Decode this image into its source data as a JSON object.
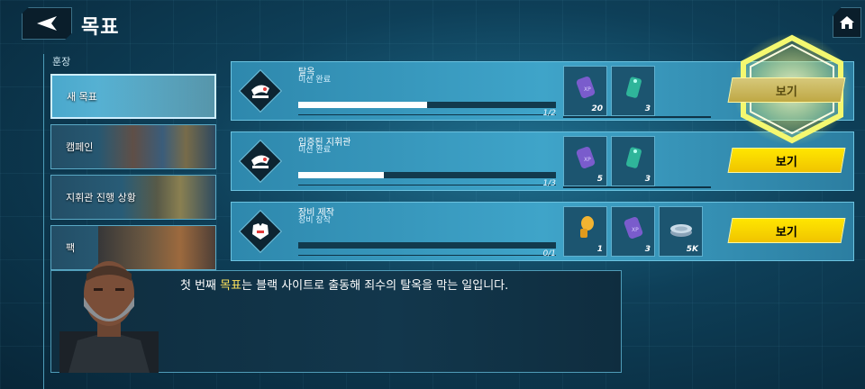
{
  "header": {
    "title": "목표",
    "back_icon": "back-arrow-icon",
    "home_icon": "home-icon"
  },
  "sidebar": {
    "header": "훈장",
    "items": [
      {
        "label": "새 목표",
        "active": true
      },
      {
        "label": "캠페인",
        "active": false
      },
      {
        "label": "지휘관 진행 상황",
        "active": false
      },
      {
        "label": "팩",
        "active": false
      }
    ]
  },
  "missions": [
    {
      "title": "탈옥",
      "subtitle": "미션 완료",
      "progress_text": "1/2",
      "progress": 0.5,
      "button": "보기",
      "button_highlighted": true,
      "rewards": [
        {
          "icon": "purple-xp-tag-icon",
          "qty": "20"
        },
        {
          "icon": "teal-dogtag-icon",
          "qty": "3"
        }
      ]
    },
    {
      "title": "입증된 지휘관",
      "subtitle": "미션 완료",
      "progress_text": "1/3",
      "progress": 0.333,
      "button": "보기",
      "button_highlighted": false,
      "rewards": [
        {
          "icon": "purple-xp-tag-icon",
          "qty": "5"
        },
        {
          "icon": "teal-dogtag-icon",
          "qty": "3"
        }
      ]
    },
    {
      "title": "장비 제작",
      "subtitle": "장비 장착",
      "progress_text": "0/1",
      "progress": 0,
      "button": "보기",
      "button_highlighted": false,
      "rewards": [
        {
          "icon": "gold-key-icon",
          "qty": "1"
        },
        {
          "icon": "purple-xp-tag-icon",
          "qty": "3"
        },
        {
          "icon": "silver-coins-icon",
          "qty": "5K"
        }
      ]
    }
  ],
  "dialog": {
    "before": "첫 번째 ",
    "highlight": "목표",
    "after": "는 블랙 사이트로 출동해 죄수의 탈옥을 막는 일입니다."
  },
  "colors": {
    "button_yellow": "#ffe600",
    "highlight_text": "#ffe45c",
    "panel_blue": "#3fa4c9"
  }
}
